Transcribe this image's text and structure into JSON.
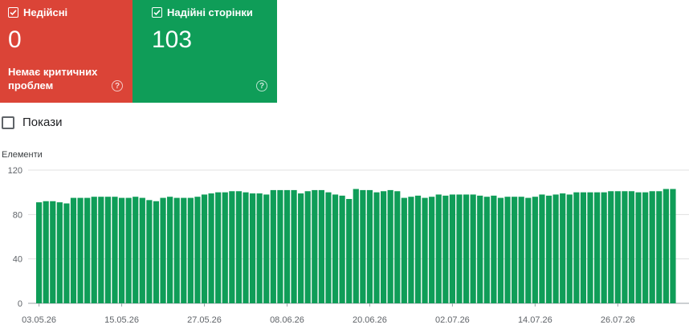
{
  "cards": {
    "invalid": {
      "label": "Недійсні",
      "value": "0",
      "description": "Немає критичних проблем",
      "color": "#db4437"
    },
    "valid": {
      "label": "Надійні сторінки",
      "value": "103",
      "color": "#0f9d58"
    }
  },
  "show_label": "Покази",
  "chart_data": {
    "type": "bar",
    "ylabel": "Елементи",
    "ylim": [
      0,
      120
    ],
    "yticks": [
      0,
      40,
      80,
      120
    ],
    "xtick_labels": [
      "03.05.26",
      "15.05.26",
      "27.05.26",
      "08.06.26",
      "20.06.26",
      "02.07.26",
      "14.07.26",
      "26.07.26"
    ],
    "bar_color": "#0f9d58",
    "values": [
      91,
      92,
      92,
      91,
      90,
      95,
      95,
      95,
      96,
      96,
      96,
      96,
      95,
      95,
      96,
      95,
      93,
      92,
      95,
      96,
      95,
      95,
      95,
      96,
      98,
      99,
      100,
      100,
      101,
      101,
      100,
      99,
      99,
      98,
      102,
      102,
      102,
      102,
      99,
      101,
      102,
      102,
      100,
      98,
      97,
      94,
      103,
      102,
      102,
      100,
      101,
      102,
      101,
      95,
      96,
      97,
      95,
      96,
      98,
      97,
      98,
      98,
      98,
      98,
      97,
      96,
      97,
      95,
      96,
      96,
      96,
      95,
      96,
      98,
      97,
      98,
      99,
      98,
      100,
      100,
      100,
      100,
      100,
      101,
      101,
      101,
      101,
      100,
      100,
      101,
      101,
      103,
      103
    ]
  }
}
